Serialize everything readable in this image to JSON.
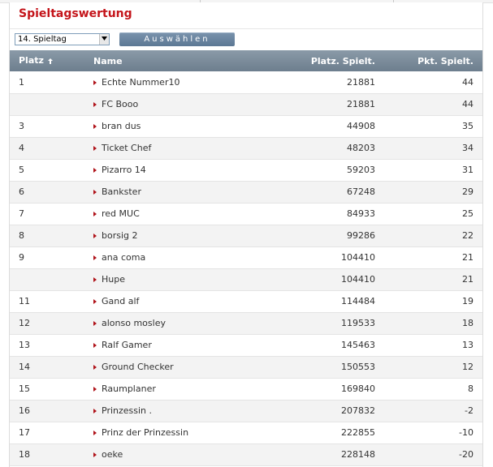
{
  "panel": {
    "title": "Spieltagswertung"
  },
  "toolbar": {
    "select_value": "14. Spieltag",
    "button_label": "Auswählen"
  },
  "table": {
    "columns": [
      "Platz",
      "Name",
      "Platz. Spielt.",
      "Pkt. Spielt."
    ],
    "rows": [
      {
        "platz": "1",
        "name": "Echte Nummer10",
        "platz_spielt": "21881",
        "pkt": "44"
      },
      {
        "platz": "",
        "name": "FC Booo",
        "platz_spielt": "21881",
        "pkt": "44"
      },
      {
        "platz": "3",
        "name": "bran dus",
        "platz_spielt": "44908",
        "pkt": "35"
      },
      {
        "platz": "4",
        "name": "Ticket Chef",
        "platz_spielt": "48203",
        "pkt": "34"
      },
      {
        "platz": "5",
        "name": "Pizarro 14",
        "platz_spielt": "59203",
        "pkt": "31"
      },
      {
        "platz": "6",
        "name": "Bankster",
        "platz_spielt": "67248",
        "pkt": "29"
      },
      {
        "platz": "7",
        "name": "red MUC",
        "platz_spielt": "84933",
        "pkt": "25"
      },
      {
        "platz": "8",
        "name": "borsig 2",
        "platz_spielt": "99286",
        "pkt": "22"
      },
      {
        "platz": "9",
        "name": "ana coma",
        "platz_spielt": "104410",
        "pkt": "21"
      },
      {
        "platz": "",
        "name": "Hupe",
        "platz_spielt": "104410",
        "pkt": "21"
      },
      {
        "platz": "11",
        "name": "Gand alf",
        "platz_spielt": "114484",
        "pkt": "19"
      },
      {
        "platz": "12",
        "name": "alonso mosley",
        "platz_spielt": "119533",
        "pkt": "18"
      },
      {
        "platz": "13",
        "name": "Ralf Gamer",
        "platz_spielt": "145463",
        "pkt": "13"
      },
      {
        "platz": "14",
        "name": "Ground Checker",
        "platz_spielt": "150553",
        "pkt": "12"
      },
      {
        "platz": "15",
        "name": "Raumplaner",
        "platz_spielt": "169840",
        "pkt": "8"
      },
      {
        "platz": "16",
        "name": "Prinzessin .",
        "platz_spielt": "207832",
        "pkt": "-2"
      },
      {
        "platz": "17",
        "name": "Prinz der Prinzessin",
        "platz_spielt": "222855",
        "pkt": "-10"
      },
      {
        "platz": "18",
        "name": "oeke",
        "platz_spielt": "228148",
        "pkt": "-20"
      }
    ]
  },
  "colors": {
    "title": "#c4141a",
    "header_bg": "#7a8b9a",
    "button_bg": "#6b8299",
    "bullet": "#b0131a"
  },
  "icons": {
    "sort": "sort-ascending-icon",
    "bullet": "bullet-triangle-icon",
    "dropdown": "chevron-down-icon"
  }
}
